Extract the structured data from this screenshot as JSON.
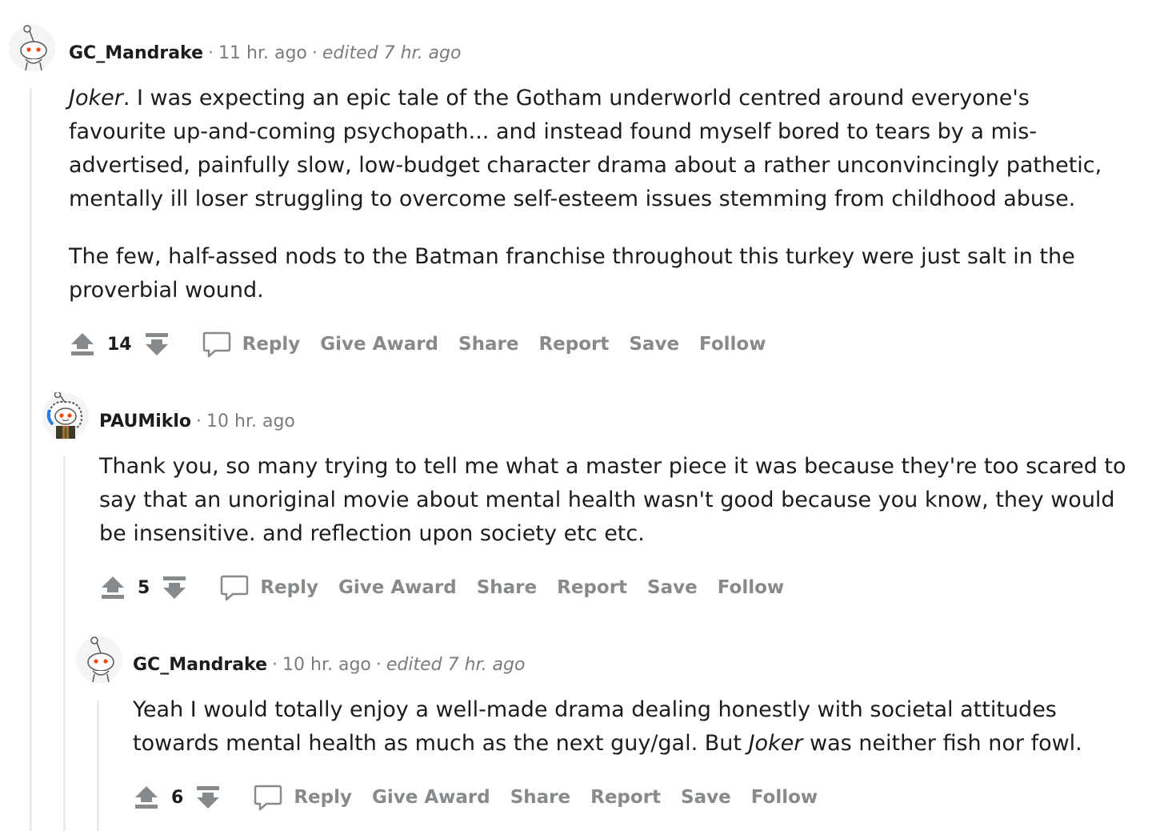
{
  "comments": [
    {
      "author": "GC_Mandrake",
      "time": "11 hr. ago",
      "edited": "edited 7 hr. ago",
      "paragraphs": [
        {
          "em": "Joker",
          "text": ". I was expecting an epic tale of the Gotham underworld centred around everyone's favourite up-and-coming psychopath... and instead found myself bored to tears by a mis-advertised, painfully slow, low-budget character drama about a rather unconvincingly pathetic, mentally ill loser struggling to overcome self-esteem issues stemming from childhood abuse."
        },
        {
          "text": "The few, half-assed nods to the Batman franchise throughout this turkey were just salt in the proverbial wound."
        }
      ],
      "score": "14"
    },
    {
      "author": "PAUMiklo",
      "time": "10 hr. ago",
      "text": "Thank you, so many trying to tell me what a master piece it was because they're too scared to say that an unoriginal movie about mental health wasn't good because you know, they would be insensitive. and reflection upon society etc etc.",
      "score": "5"
    },
    {
      "author": "GC_Mandrake",
      "time": "10 hr. ago",
      "edited": "edited 7 hr. ago",
      "text_before": "Yeah I would totally enjoy a well-made drama dealing honestly with societal attitudes towards mental health as much as the next guy/gal. But ",
      "text_em": "Joker",
      "text_after": " was neither fish nor fowl.",
      "score": "6"
    }
  ],
  "actions": {
    "reply": "Reply",
    "award": "Give Award",
    "share": "Share",
    "report": "Report",
    "save": "Save",
    "follow": "Follow"
  },
  "icons": {
    "upvote": "upvote-arrow-icon",
    "downvote": "downvote-arrow-icon",
    "reply": "speech-bubble-icon",
    "avatar": "snoo-avatar-icon"
  },
  "colors": {
    "meta": "#7c7c7c",
    "action": "#878a8c",
    "thread_line": "#ececec",
    "snoo_eye": "#ff4500"
  }
}
